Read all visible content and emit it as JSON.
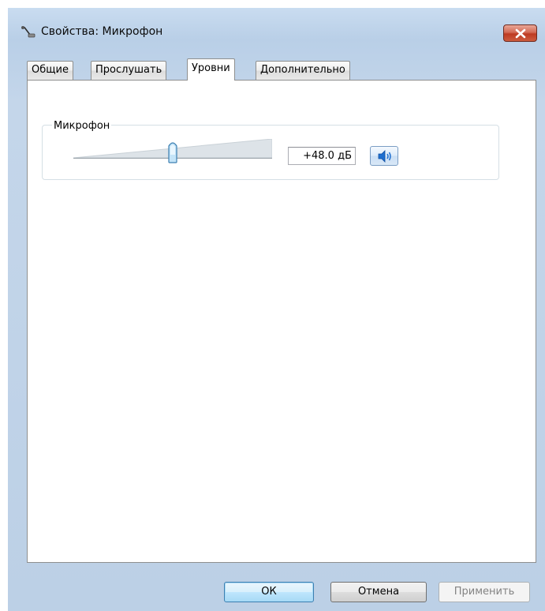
{
  "window": {
    "title": "Свойства: Микрофон"
  },
  "tabs": [
    {
      "label": "Общие"
    },
    {
      "label": "Прослушать"
    },
    {
      "label": "Уровни"
    },
    {
      "label": "Дополнительно"
    }
  ],
  "levels": {
    "group_label": "Микрофон",
    "slider_fraction": 0.5,
    "value_text": "+48.0 дБ"
  },
  "buttons": {
    "ok": "ОК",
    "cancel": "Отмена",
    "apply": "Применить"
  },
  "colors": {
    "titlebar": "#bcd1e8",
    "close_button": "#c7432b",
    "panel": "#ffffff",
    "default_button_border": "#3c7fb1"
  },
  "icons": {
    "title": "microphone-icon",
    "close": "close-icon",
    "mute": "speaker-icon",
    "slider": "slider-thumb-icon"
  }
}
